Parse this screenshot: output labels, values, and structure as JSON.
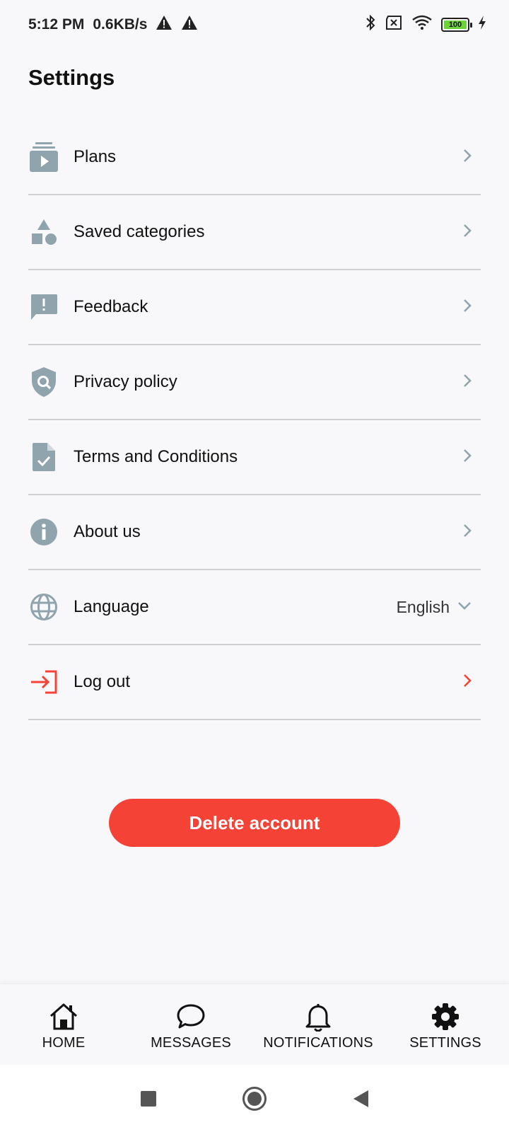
{
  "status_bar": {
    "time": "5:12 PM",
    "speed": "0.6KB/s",
    "battery": "100",
    "icons": [
      "warning-icon",
      "warning-icon",
      "bluetooth-icon",
      "no-sim-icon",
      "wifi-icon",
      "battery-icon",
      "charging-icon"
    ]
  },
  "page": {
    "title": "Settings"
  },
  "settings": {
    "items": [
      {
        "label": "Plans",
        "icon": "plans-icon"
      },
      {
        "label": "Saved categories",
        "icon": "categories-icon"
      },
      {
        "label": "Feedback",
        "icon": "feedback-icon"
      },
      {
        "label": "Privacy policy",
        "icon": "privacy-shield-icon"
      },
      {
        "label": "Terms and Conditions",
        "icon": "document-check-icon"
      },
      {
        "label": "About us",
        "icon": "info-icon"
      },
      {
        "label": "Language",
        "icon": "globe-icon",
        "value": "English"
      },
      {
        "label": "Log out",
        "icon": "logout-icon"
      }
    ]
  },
  "actions": {
    "delete_account": "Delete account"
  },
  "bottom_nav": {
    "items": [
      {
        "label": "HOME",
        "icon": "home-icon"
      },
      {
        "label": "MESSAGES",
        "icon": "message-icon"
      },
      {
        "label": "NOTIFICATIONS",
        "icon": "bell-icon"
      },
      {
        "label": "SETTINGS",
        "icon": "gear-icon",
        "active": true
      }
    ]
  },
  "colors": {
    "icon_gray": "#90a4ae",
    "danger": "#f44336",
    "background": "#f8f8fa",
    "divider": "#d0d0d4"
  }
}
